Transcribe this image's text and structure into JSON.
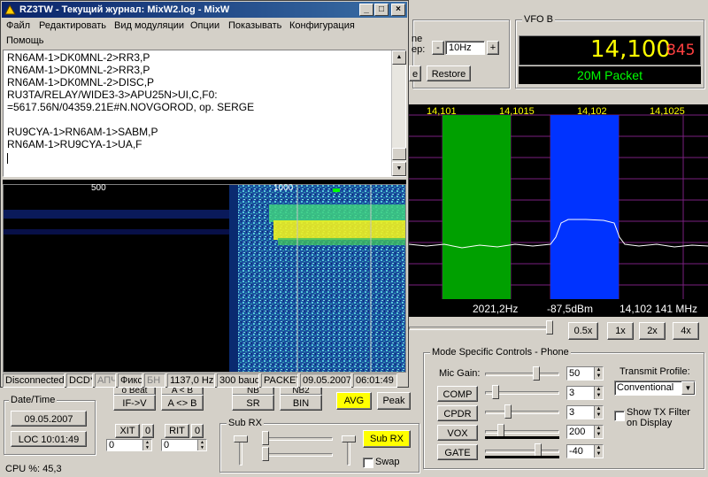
{
  "mixw": {
    "title": "RZ3TW - Текущий журнал: MixW2.log - MixW",
    "menu": [
      "Файл",
      "Редактировать",
      "Вид модуляции",
      "Опции",
      "Показывать",
      "Конфигурация",
      "Помощь"
    ],
    "log_lines": [
      "RN6AM-1>DK0MNL-2>RR3,P",
      "RN6AM-1>DK0MNL-2>RR3,P",
      "RN6AM-1>DK0MNL-2>DISC,P",
      "RU3TA/RELAY/WIDE3-3>APU25N>UI,C,F0:",
      "=5617.56N/04359.21E#N.NOVGOROD, op. SERGE",
      "",
      "RU9CYA-1>RN6AM-1>SABM,P",
      "RN6AM-1>RU9CYA-1>UA,F"
    ],
    "scale": [
      "500",
      "1000"
    ],
    "status": {
      "state": "Disconnected",
      "dcd": "DCD*",
      "apch": "АПЧ",
      "fix": "Фикс",
      "bn": "БН",
      "freq": "1137,0 Hz",
      "baud": "300 baud",
      "mode": "PACKET",
      "date": "09.05.2007",
      "time": "06:01:49"
    }
  },
  "vfo_b": {
    "title": "VFO B",
    "freq_main": "14,100",
    "freq_sub": "845",
    "mode": "20M Packet"
  },
  "tune": {
    "label_top": "ne",
    "label_step": "ep:",
    "step_value": "10Hz",
    "minus": "-",
    "plus": "+",
    "restore": "Restore",
    "left_btn": "e"
  },
  "spectrum": {
    "ticks": [
      "14,101",
      "14,1015",
      "14,102",
      "14,1025"
    ],
    "readout_hz": "2021,2Hz",
    "readout_dbm": "-87,5dBm",
    "readout_mhz": "14,102 141 MHz",
    "colors": {
      "green": "#00a000",
      "blue": "#0033ff",
      "trace": "#ffffff"
    }
  },
  "zoom": [
    "0.5x",
    "1x",
    "2x",
    "4x"
  ],
  "date_time": {
    "title": "Date/Time",
    "date": "09.05.2007",
    "loc": "LOC 10:01:49"
  },
  "cpu": "CPU %: 45,3",
  "left_controls": {
    "ifv": "IF->V",
    "aswap": "A <> B",
    "xit": "XIT",
    "rit": "RIT",
    "xit_val": "0",
    "rit_val": "0",
    "xit_field": "0",
    "rit_field": "0",
    "partial_a": "o Beat",
    "partial_b": "A < B"
  },
  "mid_controls": {
    "nb": "NB",
    "nb2": "NB2",
    "sr": "SR",
    "bin": "BIN",
    "avg": "AVG",
    "peak": "Peak"
  },
  "sub_rx": {
    "title": "Sub RX",
    "button": "Sub RX",
    "swap": "Swap"
  },
  "mode_controls": {
    "title": "Mode Specific Controls - Phone",
    "mic_gain_label": "Mic Gain:",
    "mic_gain": "50",
    "comp": "COMP",
    "comp_val": "3",
    "cpdr": "CPDR",
    "cpdr_val": "3",
    "vox": "VOX",
    "vox_val": "200",
    "gate": "GATE",
    "gate_val": "-40",
    "tx_profile_label": "Transmit Profile:",
    "tx_profile": "Conventional",
    "show_tx_filter": "Show TX Filter on Display"
  }
}
